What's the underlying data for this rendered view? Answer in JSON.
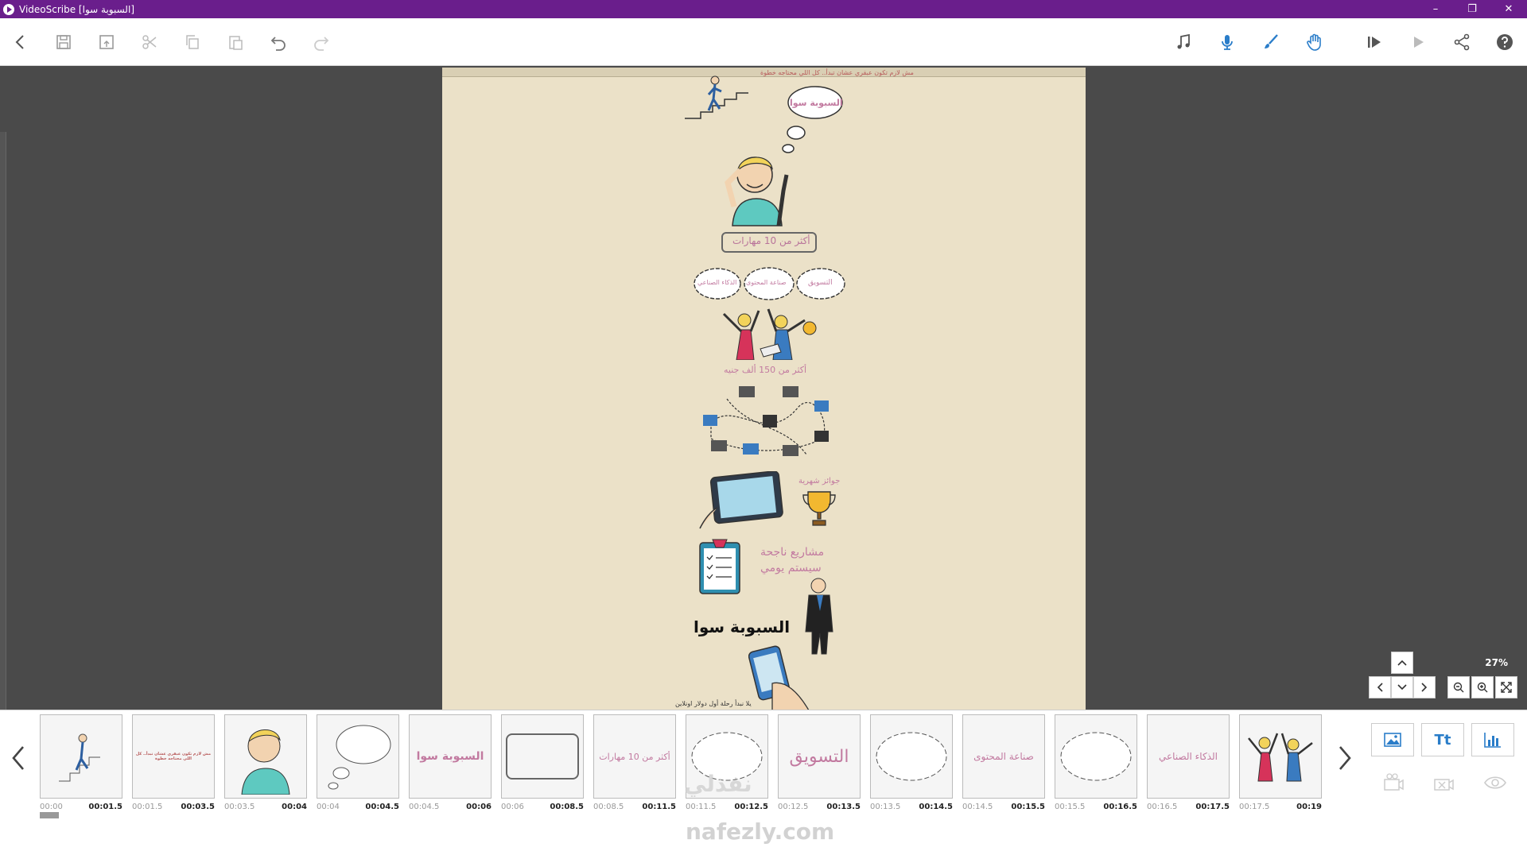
{
  "window": {
    "title": "VideoScribe [السبوبة سوا]",
    "controls": [
      "–",
      "❐",
      "✕"
    ]
  },
  "toolbar": {
    "left": [
      "back-icon",
      "save-icon",
      "save-as-icon",
      "cut-icon",
      "copy-icon",
      "paste-icon",
      "undo-icon",
      "redo-icon"
    ],
    "right": [
      "music-icon",
      "microphone-icon",
      "brush-icon",
      "hand-icon",
      "play-from-icon",
      "play-icon",
      "share-icon",
      "help-icon"
    ]
  },
  "canvas": {
    "zoom": "27%",
    "texts": {
      "top_caption": "مش لازم تكون عبقري عشان تبدأ.. كل اللي محتاجه خطوة",
      "bubble_title": "السبوبة سوا",
      "skills_box": "أكثر من 10 مهارات",
      "cloud_marketing": "التسويق",
      "cloud_content": "صناعة المحتوى",
      "cloud_ai": "الذكاء الصناعي",
      "earnings": "أكثر من 150 ألف جنيه",
      "monthly_prizes": "جوائز شهرية",
      "projects_line1": "مشاريع ناجحة",
      "projects_line2": "سيستم يومي",
      "big_title": "السبوبة سوا",
      "bottom_caption": "يلا نبدأ رحلة أول دولار اونلاين"
    }
  },
  "timeline": {
    "frames": [
      {
        "start": "00:00",
        "end": "00:01.5",
        "label": ""
      },
      {
        "start": "00:01.5",
        "end": "00:03.5",
        "label": "مش لازم تكون عبقري عشان تبدأ.. كل اللي محتاجه خطوة"
      },
      {
        "start": "00:03.5",
        "end": "00:04",
        "label": ""
      },
      {
        "start": "00:04",
        "end": "00:04.5",
        "label": ""
      },
      {
        "start": "00:04.5",
        "end": "00:06",
        "label": "السبوبة سوا"
      },
      {
        "start": "00:06",
        "end": "00:08.5",
        "label": ""
      },
      {
        "start": "00:08.5",
        "end": "00:11.5",
        "label": "أكثر من 10 مهارات"
      },
      {
        "start": "00:11.5",
        "end": "00:12.5",
        "label": ""
      },
      {
        "start": "00:12.5",
        "end": "00:13.5",
        "label": "التسويق"
      },
      {
        "start": "00:13.5",
        "end": "00:14.5",
        "label": ""
      },
      {
        "start": "00:14.5",
        "end": "00:15.5",
        "label": "صناعة المحتوى"
      },
      {
        "start": "00:15.5",
        "end": "00:16.5",
        "label": ""
      },
      {
        "start": "00:16.5",
        "end": "00:17.5",
        "label": "الذكاء الصناعي"
      },
      {
        "start": "00:17.5",
        "end": "00:19",
        "label": ""
      }
    ],
    "side_buttons": {
      "image": "image-icon",
      "text": "Tt",
      "chart": "chart-icon"
    }
  },
  "watermark": {
    "line1": "نفذلي",
    "line2": "nafezly.com"
  }
}
